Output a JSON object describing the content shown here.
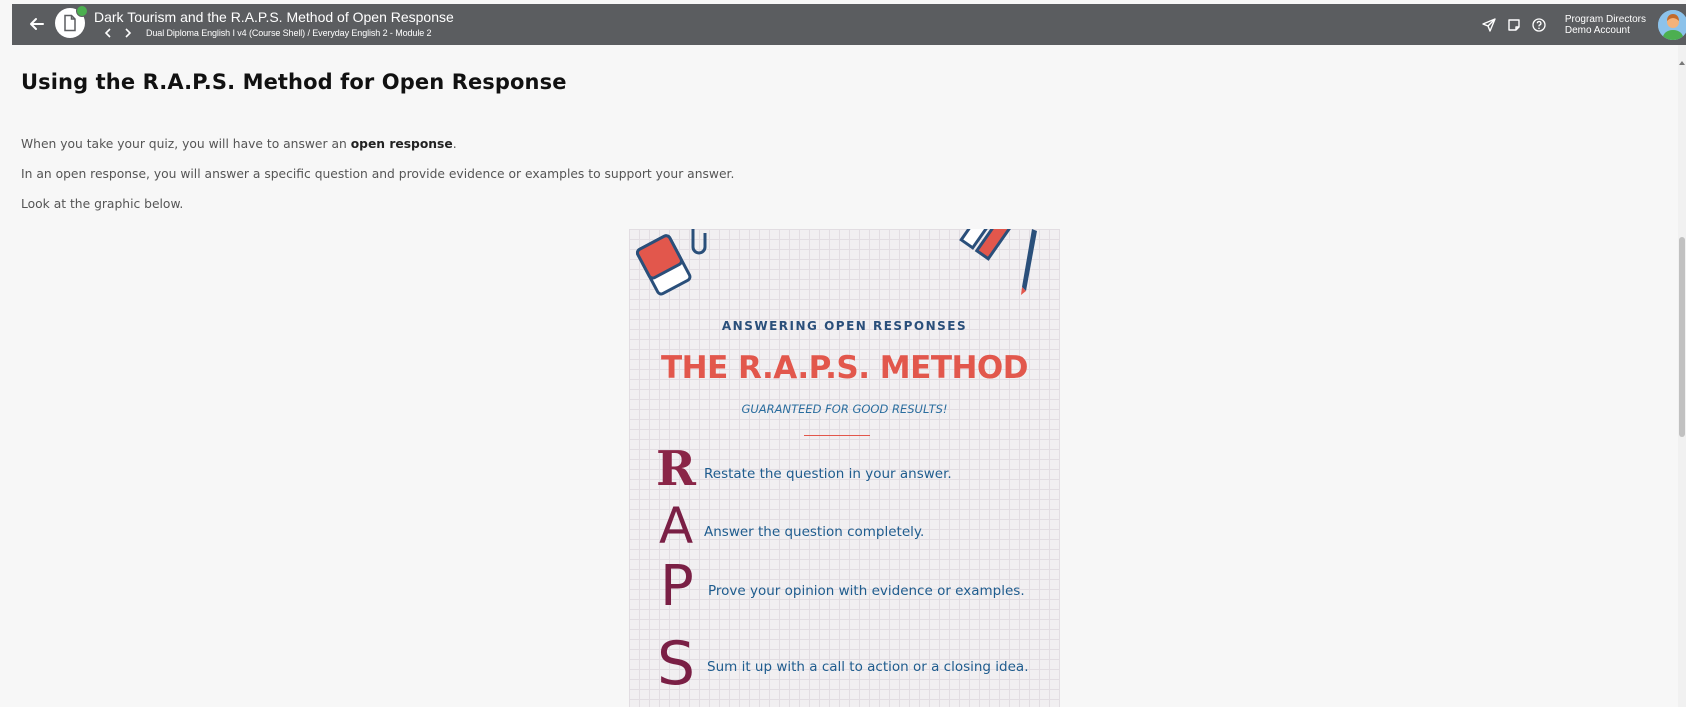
{
  "topbar": {
    "title": "Dark Tourism and the R.A.P.S. Method of Open Response",
    "breadcrumb": "Dual Diploma English I v4 (Course Shell) / Everyday English 2 - Module 2",
    "user_role": "Program Directors",
    "user_name": "Demo Account",
    "icons": [
      "back-arrow-icon",
      "document-icon",
      "chevron-left-icon",
      "chevron-right-icon",
      "send-icon",
      "notes-icon",
      "help-icon",
      "avatar"
    ]
  },
  "main": {
    "heading": "Using the R.A.P.S. Method for Open Response",
    "p1_before": "When you take your quiz, you will have to answer an ",
    "p1_bold": "open response",
    "p1_after": ".",
    "p2": "In an open response, you will answer a specific question and provide evidence or examples to support your answer.",
    "p3": "Look at the graphic below."
  },
  "graphic": {
    "kicker": "ANSWERING OPEN RESPONSES",
    "title": "THE R.A.P.S. METHOD",
    "subtitle": "GUARANTEED FOR GOOD RESULTS!",
    "steps": [
      {
        "letter": "R",
        "text": "Restate the question in your answer."
      },
      {
        "letter": "A",
        "text": "Answer the question completely."
      },
      {
        "letter": "P",
        "text": "Prove your opinion with evidence or examples."
      },
      {
        "letter": "S",
        "text": "Sum it up with a call to action or a closing idea."
      }
    ],
    "colors": {
      "title": "#e2574c",
      "text": "#1f5c8e",
      "letters": "#7a1f45"
    }
  }
}
